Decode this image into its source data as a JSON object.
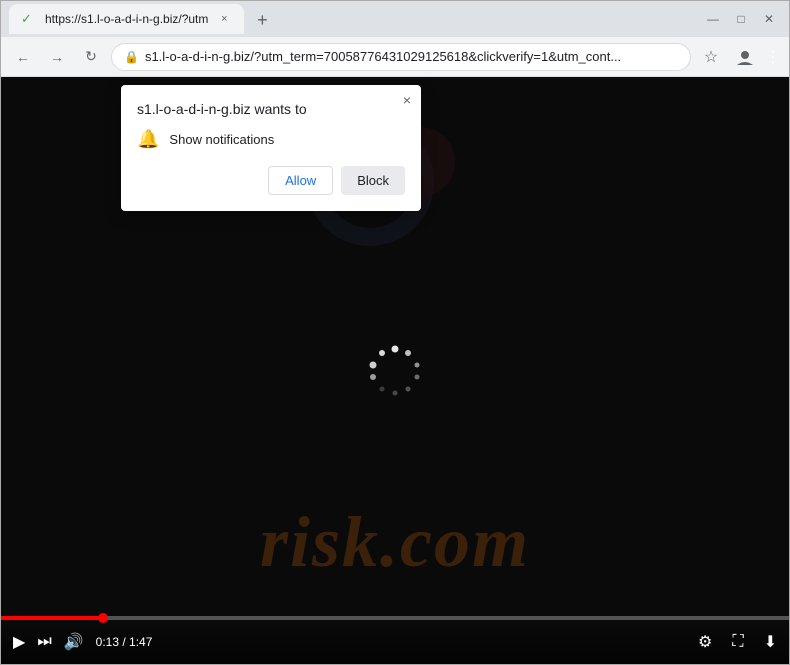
{
  "browser": {
    "tab": {
      "title": "https://s1.l-o-a-d-i-n-g.biz/?utm",
      "favicon": "✓",
      "close": "×"
    },
    "new_tab_label": "+",
    "window_controls": {
      "minimize": "—",
      "maximize": "□",
      "close": "✕"
    },
    "address_bar": {
      "url": "s1.l-o-a-d-i-n-g.biz/?utm_term=70058776431029125618&clickverify=1&utm_cont...",
      "lock_icon": "🔒"
    },
    "nav": {
      "back": "←",
      "forward": "→",
      "refresh": "↻"
    }
  },
  "notification_popup": {
    "title": "s1.l-o-a-d-i-n-g.biz wants to",
    "close_icon": "×",
    "notification_label": "Show notifications",
    "allow_button": "Allow",
    "block_button": "Block"
  },
  "video": {
    "time_current": "0:13",
    "time_total": "1:47",
    "watermark": "risk.com"
  }
}
